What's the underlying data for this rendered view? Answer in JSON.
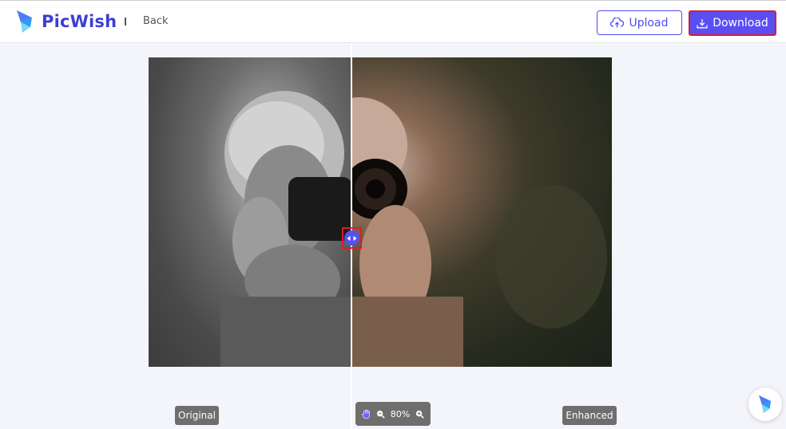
{
  "header": {
    "brand": "PicWish",
    "back_label": "Back",
    "upload_label": "Upload",
    "download_label": "Download"
  },
  "viewer": {
    "left_label": "Original",
    "right_label": "Enhanced",
    "zoom_level": "80%"
  },
  "colors": {
    "accent": "#5a4ef2",
    "brand_text": "#3d3dd6",
    "highlight": "#d4202c",
    "chip_bg": "#6e6e6e"
  },
  "icons": {
    "logo": "picwish-logo-icon",
    "upload": "cloud-upload-icon",
    "download": "download-icon",
    "compare_handle": "left-right-arrows-icon",
    "hand": "hand-icon",
    "zoom_out": "zoom-out-icon",
    "zoom_in": "zoom-in-icon",
    "assistant": "picwish-assistant-icon"
  }
}
